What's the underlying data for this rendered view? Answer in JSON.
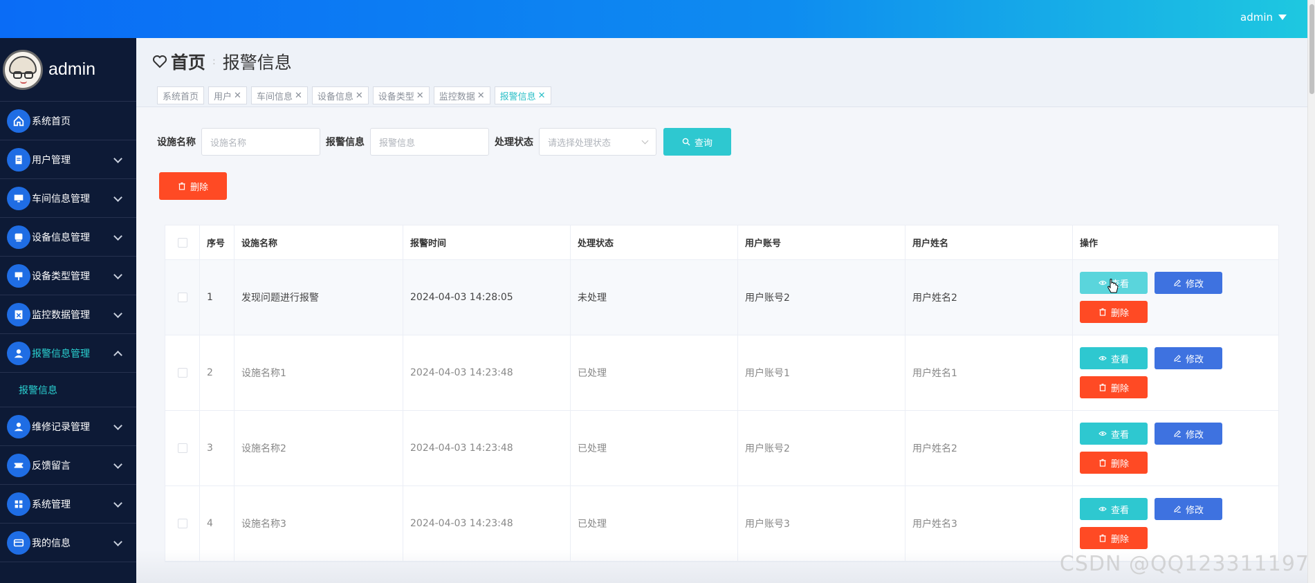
{
  "header": {
    "user": "admin"
  },
  "sidebar": {
    "username": "admin",
    "items": [
      {
        "label": "系统首页",
        "icon": "home-icon"
      },
      {
        "label": "用户管理",
        "icon": "clipboard-icon"
      },
      {
        "label": "车间信息管理",
        "icon": "monitor-icon"
      },
      {
        "label": "设备信息管理",
        "icon": "device-icon"
      },
      {
        "label": "设备类型管理",
        "icon": "type-icon"
      },
      {
        "label": "监控数据管理",
        "icon": "monitor-data-icon"
      },
      {
        "label": "报警信息管理",
        "icon": "alarm-icon"
      },
      {
        "label": "报警信息",
        "icon": ""
      },
      {
        "label": "维修记录管理",
        "icon": "user-icon"
      },
      {
        "label": "反馈留言",
        "icon": "ticket-icon"
      },
      {
        "label": "系统管理",
        "icon": "grid-icon"
      },
      {
        "label": "我的信息",
        "icon": "card-icon"
      }
    ]
  },
  "breadcrumb": {
    "home": "首页",
    "current": "报警信息"
  },
  "tabs": [
    {
      "label": "系统首页",
      "closable": false
    },
    {
      "label": "用户",
      "closable": true
    },
    {
      "label": "车间信息",
      "closable": true
    },
    {
      "label": "设备信息",
      "closable": true
    },
    {
      "label": "设备类型",
      "closable": true
    },
    {
      "label": "监控数据",
      "closable": true
    },
    {
      "label": "报警信息",
      "closable": true
    }
  ],
  "search": {
    "facility_label": "设施名称",
    "facility_placeholder": "设施名称",
    "alarm_label": "报警信息",
    "alarm_placeholder": "报警信息",
    "status_label": "处理状态",
    "status_placeholder": "请选择处理状态",
    "query_button": "查询"
  },
  "toolbar": {
    "delete_button": "删除"
  },
  "table": {
    "columns": [
      "序号",
      "设施名称",
      "报警时间",
      "处理状态",
      "用户账号",
      "用户姓名",
      "操作"
    ],
    "rows": [
      {
        "no": "1",
        "facility": "发现问题进行报警",
        "time": "2024-04-03 14:28:05",
        "status": "未处理",
        "account": "用户账号2",
        "name": "用户姓名2"
      },
      {
        "no": "2",
        "facility": "设施名称1",
        "time": "2024-04-03 14:23:48",
        "status": "已处理",
        "account": "用户账号1",
        "name": "用户姓名1"
      },
      {
        "no": "3",
        "facility": "设施名称2",
        "time": "2024-04-03 14:23:48",
        "status": "已处理",
        "account": "用户账号2",
        "name": "用户姓名2"
      },
      {
        "no": "4",
        "facility": "设施名称3",
        "time": "2024-04-03 14:23:48",
        "status": "已处理",
        "account": "用户账号3",
        "name": "用户姓名3"
      }
    ],
    "actions": {
      "view": "查看",
      "edit": "修改",
      "delete": "删除"
    }
  },
  "watermark": "CSDN @QQ123311197"
}
